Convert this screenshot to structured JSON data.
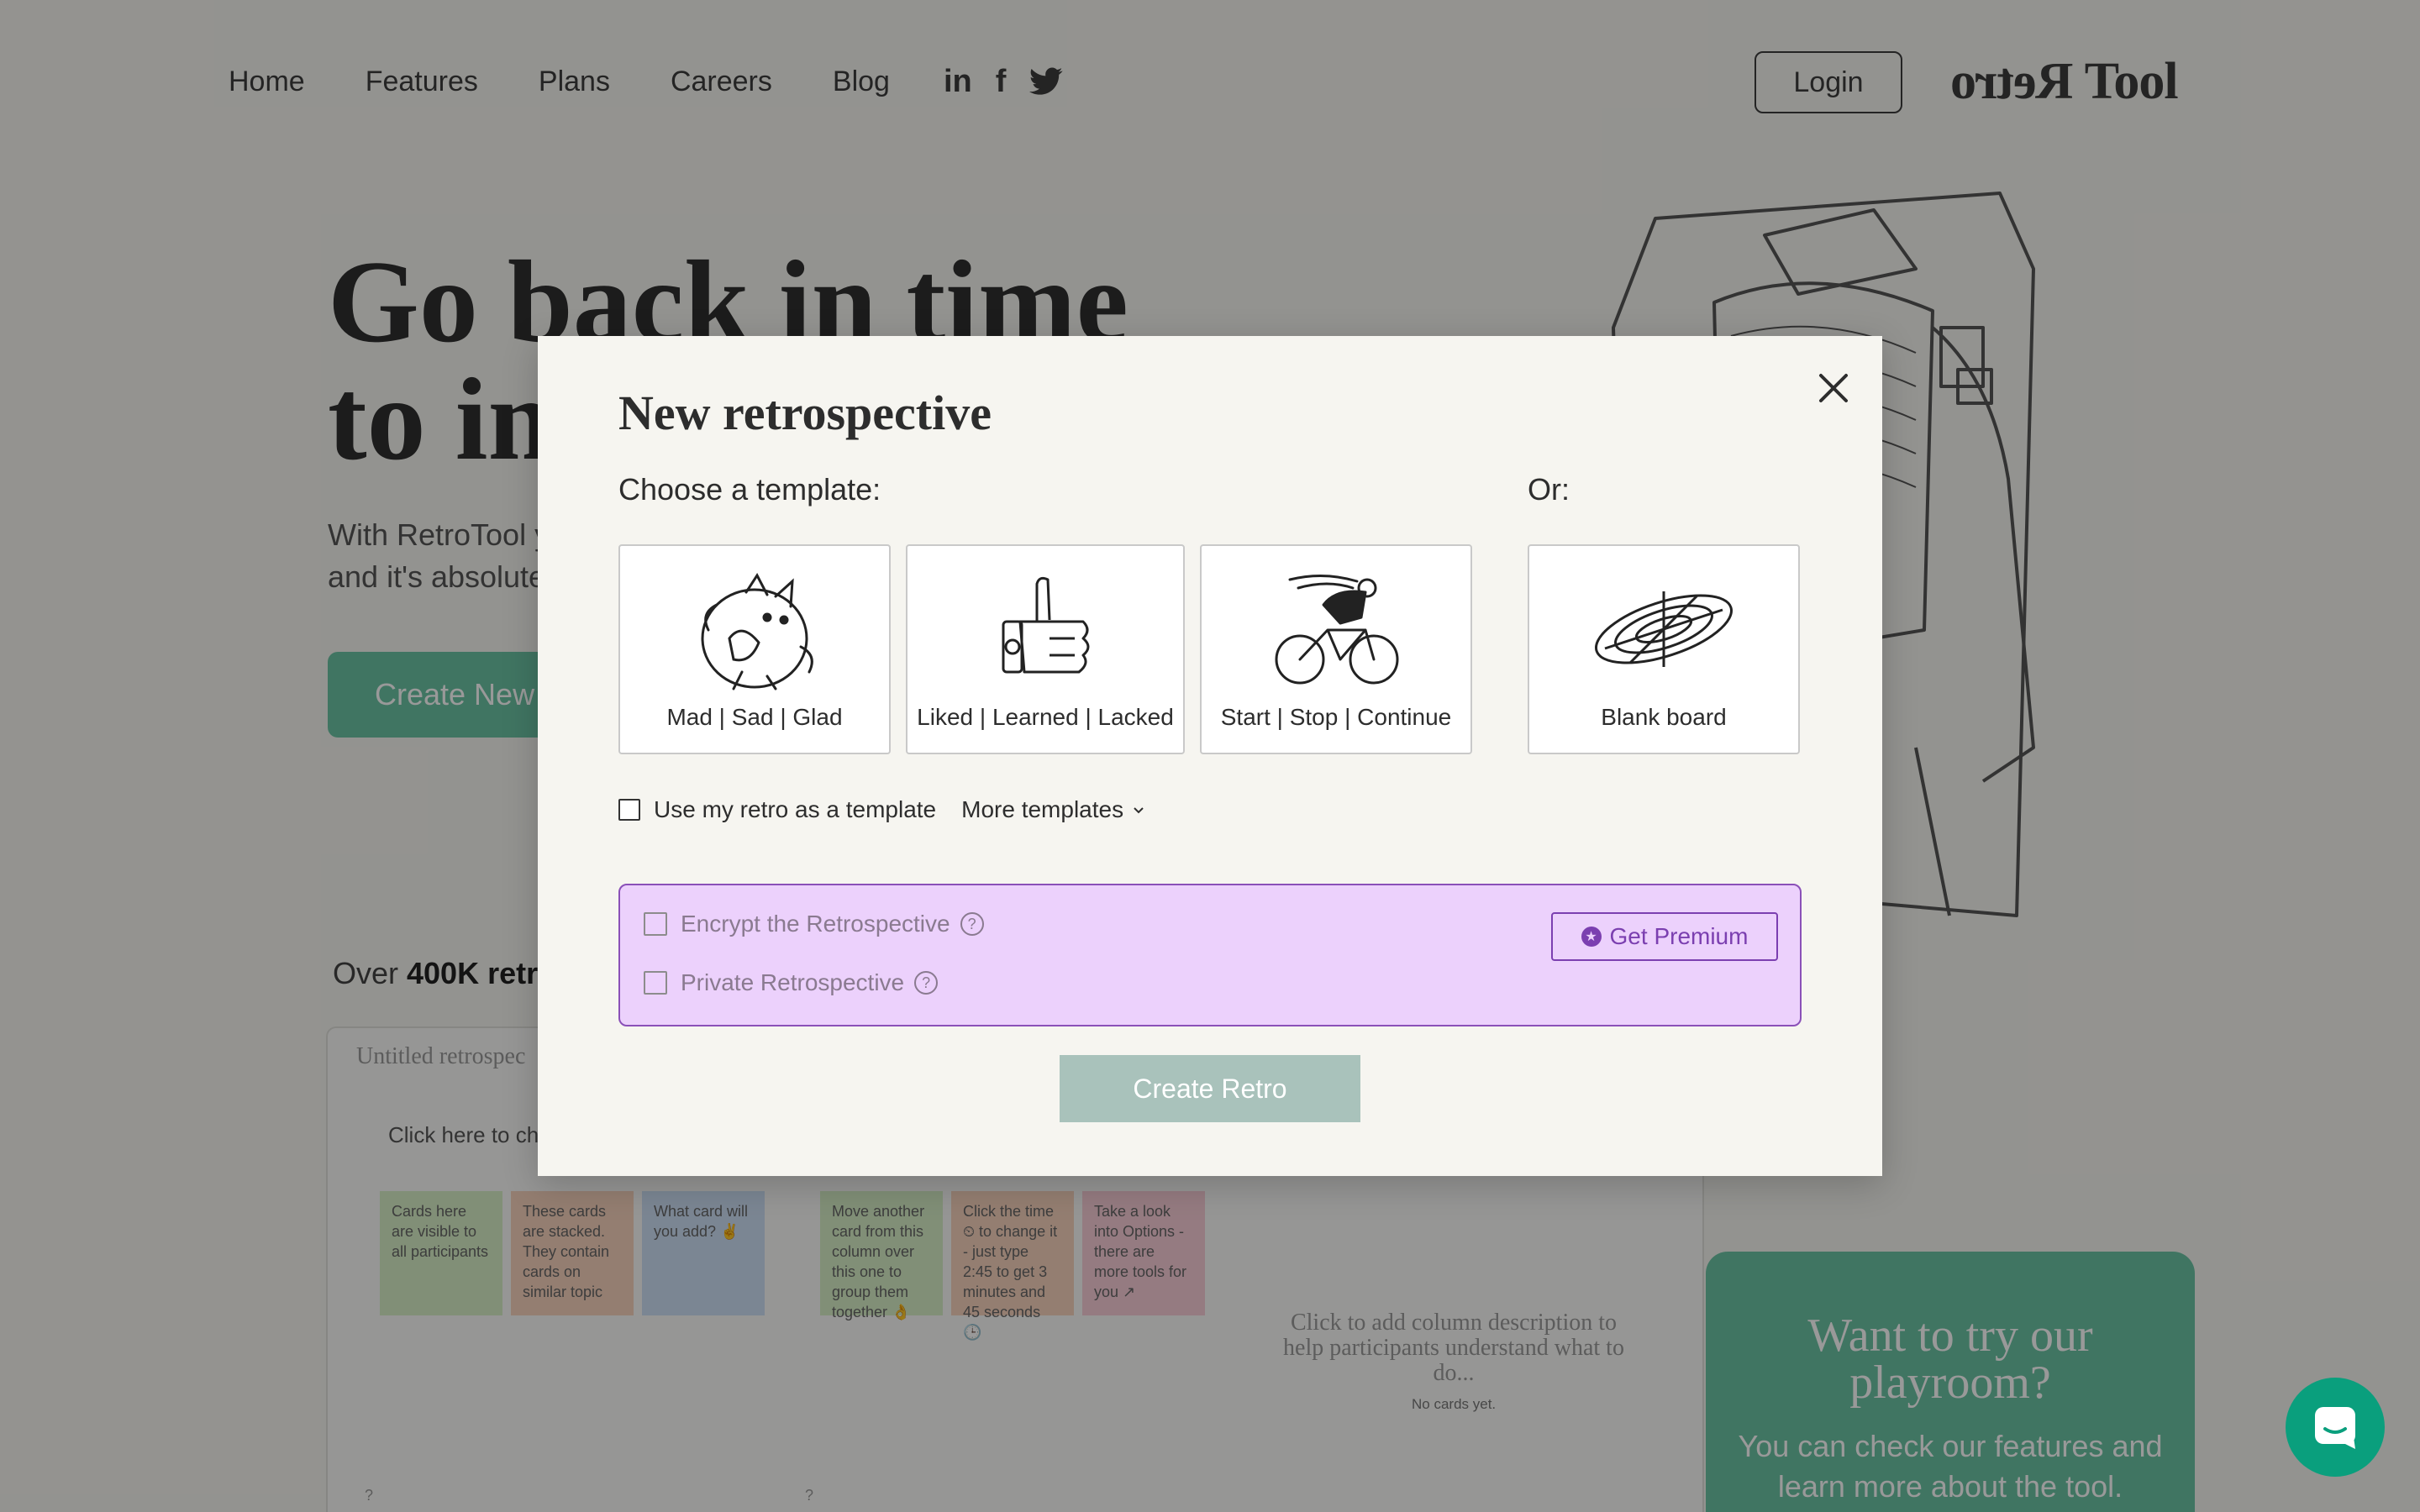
{
  "nav": {
    "links": [
      "Home",
      "Features",
      "Plans",
      "Careers",
      "Blog"
    ],
    "socials": [
      "in",
      "f"
    ],
    "login": "Login",
    "logo_mirrored": "Retro",
    "logo_text": "Tool"
  },
  "hero": {
    "title_line1": "Go back in time",
    "title_line2": "to im",
    "subtitle_line1": "With RetroTool y",
    "subtitle_line2": "and it's absolute",
    "cta": "Create New"
  },
  "stats": {
    "prefix": "Over ",
    "bold": "400K retr"
  },
  "demo": {
    "title": "Untitled retrospec",
    "hint": "Click here to cha",
    "cards": [
      "Cards here are visible to all participants",
      "These cards are stacked. They contain cards on similar topic",
      "What card will you add? ✌",
      "Move another card from this column over this one to group them together 👌",
      "Click the time ⏲ to change it - just type 2:45 to get 3 minutes and 45 seconds 🕒",
      "Take a look into Options - there are more tools for you ↗"
    ],
    "column_desc": "Click to add column description to help participants understand what to do...",
    "no_cards": "No cards yet."
  },
  "playroom": {
    "title": "Want to try our playroom?",
    "text": "You can check our features and learn more about the tool."
  },
  "modal": {
    "title": "New retrospective",
    "choose_label": "Choose a template:",
    "or_label": "Or:",
    "templates": [
      {
        "label": "Mad | Sad | Glad",
        "icon": "cat-icon"
      },
      {
        "label": "Liked | Learned | Lacked",
        "icon": "thumbs-up-icon"
      },
      {
        "label": "Start | Stop | Continue",
        "icon": "cyclist-icon"
      }
    ],
    "blank_board": "Blank board",
    "use_as_template": "Use my retro as a template",
    "more_templates": "More templates",
    "encrypt": "Encrypt the Retrospective",
    "private": "Private Retrospective",
    "help_glyph": "?",
    "get_premium": "Get Premium",
    "create": "Create Retro"
  },
  "colors": {
    "accent_green": "#6cc4a4",
    "premium_bg": "#ecd1fc",
    "premium_border": "#8a50b8",
    "create_disabled": "#a9c2bb",
    "chat_fab": "#0a9f7d"
  }
}
